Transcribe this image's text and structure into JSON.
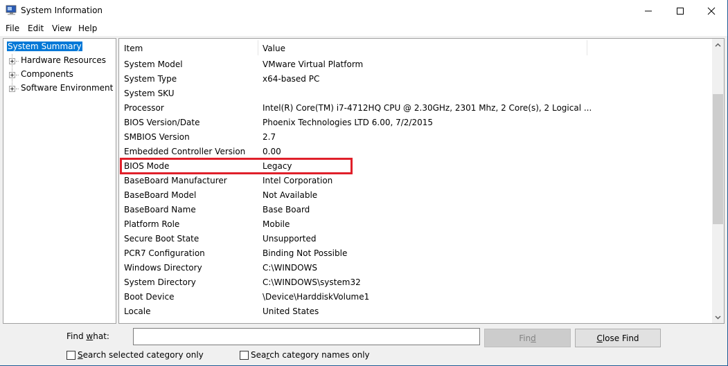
{
  "window": {
    "title": "System Information",
    "controls": {
      "minimize": "minimize",
      "maximize": "maximize",
      "close": "close"
    }
  },
  "menu": [
    "File",
    "Edit",
    "View",
    "Help"
  ],
  "tree": {
    "selected": "System Summary",
    "children": [
      "Hardware Resources",
      "Components",
      "Software Environment"
    ]
  },
  "table": {
    "columns": [
      "Item",
      "Value"
    ],
    "rows": [
      {
        "item": "System Model",
        "value": "VMware Virtual Platform"
      },
      {
        "item": "System Type",
        "value": "x64-based PC"
      },
      {
        "item": "System SKU",
        "value": ""
      },
      {
        "item": "Processor",
        "value": "Intel(R) Core(TM) i7-4712HQ CPU @ 2.30GHz, 2301 Mhz, 2 Core(s), 2 Logical ..."
      },
      {
        "item": "BIOS Version/Date",
        "value": "Phoenix Technologies LTD 6.00, 7/2/2015"
      },
      {
        "item": "SMBIOS Version",
        "value": "2.7"
      },
      {
        "item": "Embedded Controller Version",
        "value": "0.00"
      },
      {
        "item": "BIOS Mode",
        "value": "Legacy"
      },
      {
        "item": "BaseBoard Manufacturer",
        "value": "Intel Corporation"
      },
      {
        "item": "BaseBoard Model",
        "value": "Not Available"
      },
      {
        "item": "BaseBoard Name",
        "value": "Base Board"
      },
      {
        "item": "Platform Role",
        "value": "Mobile"
      },
      {
        "item": "Secure Boot State",
        "value": "Unsupported"
      },
      {
        "item": "PCR7 Configuration",
        "value": "Binding Not Possible"
      },
      {
        "item": "Windows Directory",
        "value": "C:\\WINDOWS"
      },
      {
        "item": "System Directory",
        "value": "C:\\WINDOWS\\system32"
      },
      {
        "item": "Boot Device",
        "value": "\\Device\\HarddiskVolume1"
      },
      {
        "item": "Locale",
        "value": "United States"
      }
    ],
    "highlighted_row": "BIOS Mode",
    "highlight_color": "#e0202a"
  },
  "find": {
    "label_pre": "Find ",
    "label_accel": "w",
    "label_post": "hat:",
    "value": "",
    "find_button": {
      "pre": "Fin",
      "accel": "d",
      "post": ""
    },
    "close_button": {
      "pre": "",
      "accel": "C",
      "post": "lose Find"
    },
    "check1": {
      "pre": "",
      "accel": "S",
      "post": "earch selected category only",
      "checked": false
    },
    "check2": {
      "pre": "Sea",
      "accel": "r",
      "post": "ch category names only",
      "checked": false
    }
  },
  "colors": {
    "selection": "#0078d7",
    "window_border": "#1e5b94"
  }
}
